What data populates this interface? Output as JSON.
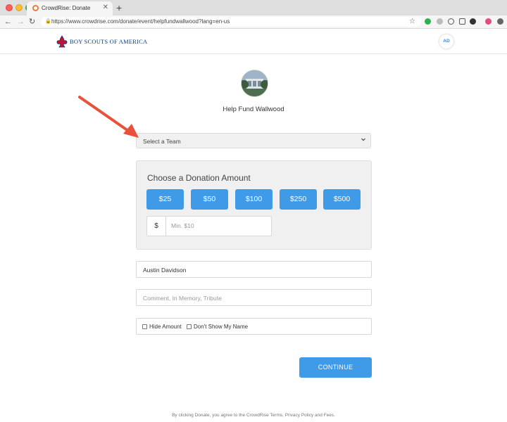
{
  "browser": {
    "tab_title": "CrowdRise: Donate",
    "tab_close": "✕",
    "new_tab": "+",
    "url": "https://www.crowdrise.com/donate/event/helpfundwallwood?lang=en-us",
    "lock_glyph": "🔒",
    "star_glyph": "☆",
    "back_glyph": "←",
    "forward_glyph": "→",
    "reload_glyph": "↻"
  },
  "header": {
    "logo_text": "BOY SCOUTS OF AMERICA",
    "avatar_initials": "AD"
  },
  "event": {
    "title": "Help Fund Wallwood"
  },
  "team_select": {
    "selected": "Select a Team"
  },
  "donation": {
    "title": "Choose a Donation Amount",
    "amounts": [
      "$25",
      "$50",
      "$100",
      "$250",
      "$500"
    ],
    "currency_symbol": "$",
    "custom_placeholder": "Min. $10"
  },
  "form": {
    "name_value": "Austin Davidson",
    "comment_placeholder": "Comment, In Memory, Tribute",
    "hide_amount_label": "Hide Amount",
    "hide_name_label": "Don't Show My Name",
    "continue_label": "CONTINUE"
  },
  "footer": {
    "note": "By clicking Donate, you agree to the CrowdRise Terms, Privacy Policy and Fees."
  },
  "colors": {
    "accent": "#3f9ae8",
    "annotation_arrow": "#e8513a",
    "panel_bg": "#f0f0f0"
  }
}
